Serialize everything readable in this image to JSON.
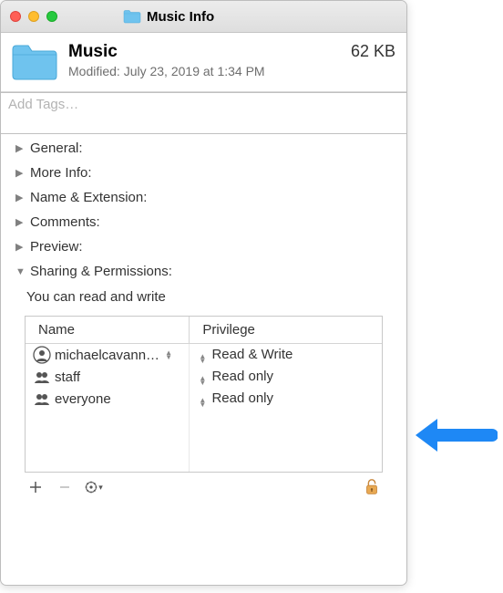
{
  "window": {
    "title": "Music Info"
  },
  "header": {
    "name": "Music",
    "size": "62 KB",
    "modified_label": "Modified:",
    "modified_value": "July 23, 2019 at 1:34 PM"
  },
  "tags": {
    "placeholder": "Add Tags…"
  },
  "sections": {
    "general": "General:",
    "more_info": "More Info:",
    "name_ext": "Name & Extension:",
    "comments": "Comments:",
    "preview": "Preview:",
    "sharing": "Sharing & Permissions:"
  },
  "permissions": {
    "note": "You can read and write",
    "columns": {
      "name": "Name",
      "privilege": "Privilege"
    },
    "rows": [
      {
        "icon": "user",
        "name": "michaelcavann…",
        "privilege": "Read & Write"
      },
      {
        "icon": "group",
        "name": "staff",
        "privilege": "Read only"
      },
      {
        "icon": "group",
        "name": "everyone",
        "privilege": "Read only"
      }
    ]
  }
}
